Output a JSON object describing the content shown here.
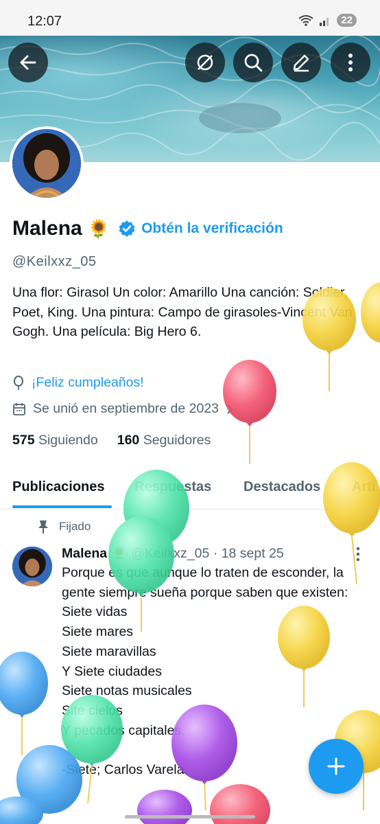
{
  "status_bar": {
    "time": "12:07",
    "battery": "22"
  },
  "header": {
    "back_icon": "arrow-left-icon",
    "actions": [
      "no-sync-icon",
      "search-icon",
      "edit-icon",
      "more-vertical-icon"
    ]
  },
  "profile": {
    "name": "Malena",
    "name_emoji": "🌻",
    "verify_label": "Obtén la verificación",
    "handle": "@Keilxxz_05",
    "bio": "Una flor: Girasol Un color: Amarillo Una canción: Soldier, Poet, King. Una pintura: Campo de girasoles-Vincent Van Gogh. Una película: Big Hero 6.",
    "birthday_label": "¡Feliz cumpleaños!",
    "joined_label": "Se unió en septiembre de 2023",
    "following_count": "575",
    "following_label": "Siguiendo",
    "followers_count": "160",
    "followers_label": "Seguidores"
  },
  "tabs": [
    "Publicaciones",
    "Respuestas",
    "Destacados",
    "Artí"
  ],
  "active_tab": "Publicaciones",
  "post": {
    "pinned_label": "Fijado",
    "author": "Malena",
    "author_emoji": "🌻",
    "handle": "@Keilxxz_05",
    "separator": "·",
    "date": "18 sept 25",
    "text": "Porque es que aunque lo traten de esconder, la gente siempre sueña porque saben que existen:\nSiete vidas\nSiete mares\nSiete maravillas\nY Siete ciudades\nSiete notas musicales\nSite cielos\nY pecados capitales.\n\n-Siete; Carlos Varela."
  },
  "colors": {
    "accent": "#1d9bf0",
    "text": "#0f1419",
    "muted": "#536471",
    "balloon_yellow": "#f5d33c",
    "balloon_green": "#4fe3a9",
    "balloon_red": "#f4546e",
    "balloon_blue": "#4aa8f2",
    "balloon_purple": "#a64ce6"
  }
}
